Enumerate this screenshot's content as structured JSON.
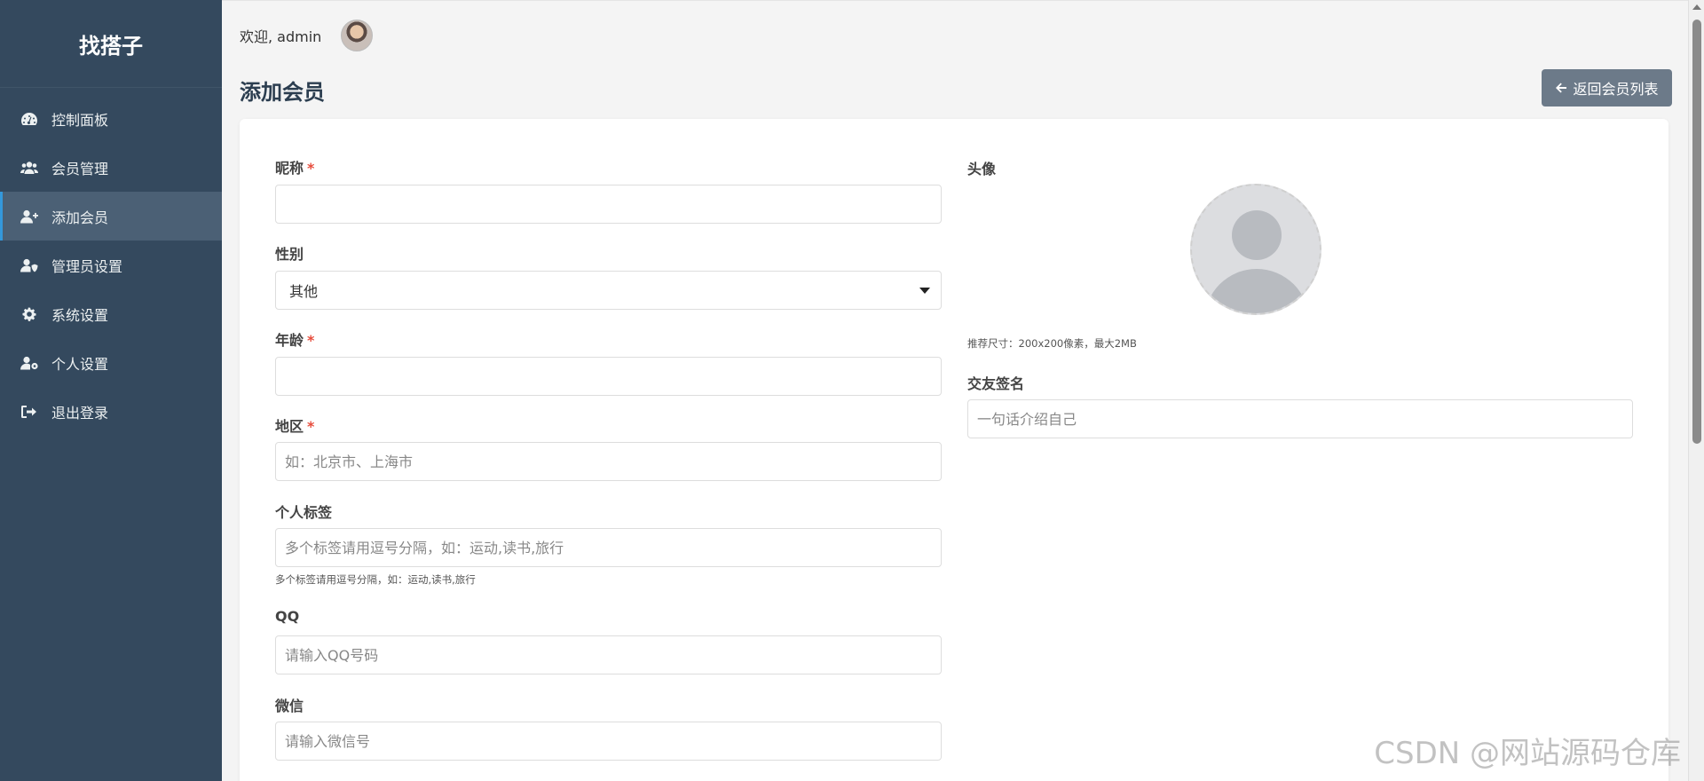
{
  "sidebar": {
    "brand": "找搭子",
    "items": [
      {
        "label": "控制面板",
        "icon": "dashboard-icon"
      },
      {
        "label": "会员管理",
        "icon": "users-icon"
      },
      {
        "label": "添加会员",
        "icon": "user-plus-icon",
        "active": true
      },
      {
        "label": "管理员设置",
        "icon": "user-shield-icon"
      },
      {
        "label": "系统设置",
        "icon": "gear-icon"
      },
      {
        "label": "个人设置",
        "icon": "user-cog-icon"
      },
      {
        "label": "退出登录",
        "icon": "sign-out-icon"
      }
    ]
  },
  "header": {
    "welcome": "欢迎, admin",
    "page_title": "添加会员",
    "back_button": "返回会员列表"
  },
  "form": {
    "nickname": {
      "label": "昵称",
      "required_mark": "*",
      "value": "",
      "placeholder": ""
    },
    "gender": {
      "label": "性别",
      "selected": "其他"
    },
    "age": {
      "label": "年龄",
      "required_mark": "*",
      "value": "",
      "placeholder": ""
    },
    "region": {
      "label": "地区",
      "required_mark": "*",
      "placeholder": "如：北京市、上海市"
    },
    "tags": {
      "label": "个人标签",
      "placeholder": "多个标签请用逗号分隔，如：运动,读书,旅行",
      "hint": "多个标签请用逗号分隔，如：运动,读书,旅行"
    },
    "qq": {
      "label": "QQ",
      "placeholder": "请输入QQ号码"
    },
    "wechat": {
      "label": "微信",
      "placeholder": "请输入微信号"
    },
    "avatar": {
      "label": "头像",
      "hint": "推荐尺寸：200x200像素，最大2MB"
    },
    "signature": {
      "label": "交友签名",
      "placeholder": "一句话介绍自己"
    }
  },
  "watermark": "CSDN @网站源码仓库",
  "colors": {
    "sidebar_bg": "#34495e",
    "active_border": "#3498db",
    "required": "#e74c3c",
    "back_button_bg": "#6c7a89"
  }
}
